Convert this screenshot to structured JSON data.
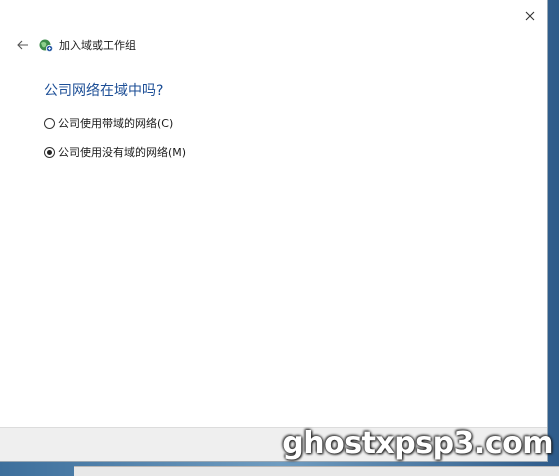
{
  "window": {
    "title": "加入域或工作组",
    "close_icon": "close-icon",
    "back_icon": "back-arrow-icon",
    "app_icon": "network-globe-icon"
  },
  "main": {
    "question": "公司网络在域中吗?",
    "options": [
      {
        "label": "公司使用带域的网络(C)",
        "checked": false
      },
      {
        "label": "公司使用没有域的网络(M)",
        "checked": true
      }
    ]
  },
  "watermark": "ghostxpsp3.com"
}
